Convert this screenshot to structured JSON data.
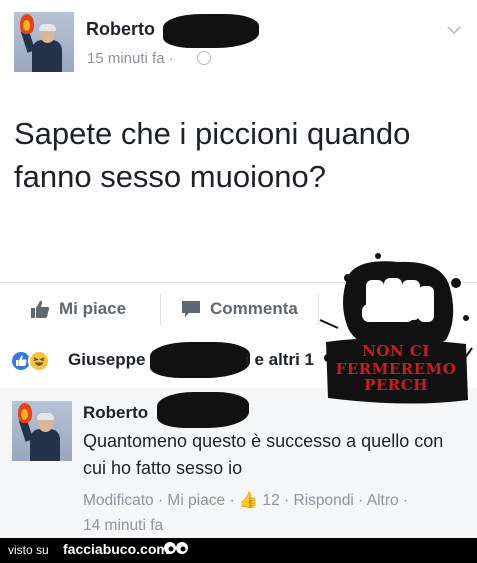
{
  "post": {
    "author": "Roberto",
    "timestamp": "15 minuti fa ·",
    "text": "Sapete che i piccioni quando fanno sesso muoiono?"
  },
  "actions": {
    "like": "Mi piace",
    "comment": "Commenta"
  },
  "reactions": {
    "names": "Giuseppe",
    "tail": "i e altri 1"
  },
  "comment": {
    "author": "Roberto",
    "text": "Quantomeno questo è successo a quello con cui ho fatto sesso io",
    "meta_line1": "Modificato · Mi piace · 👍 12 · Rispondi · Altro ·",
    "meta_line2": "14 minuti fa"
  },
  "stamp": {
    "line1": "NON CI",
    "line2": "FERMEREMO",
    "line3": "PERCH"
  },
  "footer": {
    "visto": "visto su",
    "site": "facciabuco.com"
  },
  "colors": {
    "accent": "#3578e5",
    "muted": "#90949c",
    "stamp_red": "#c81e1e"
  }
}
